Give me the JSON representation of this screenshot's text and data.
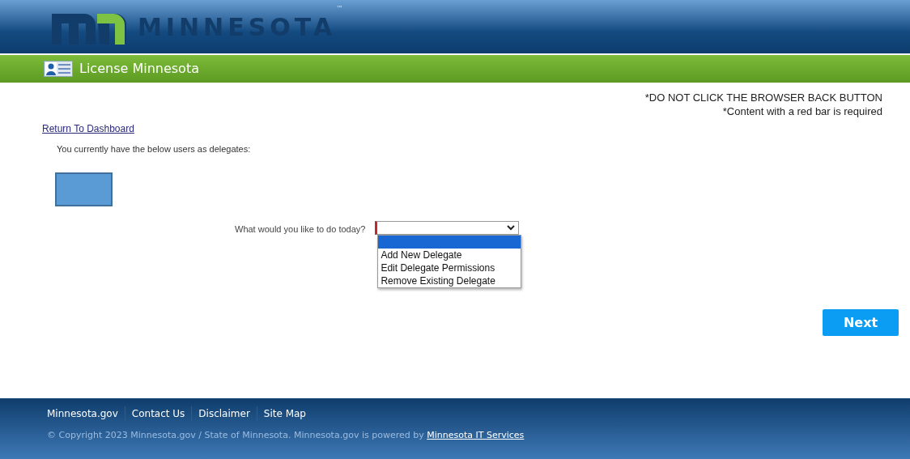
{
  "header": {
    "brand": "MINNESOTA",
    "trademark": "™"
  },
  "app_bar": {
    "title": "License Minnesota"
  },
  "notices": [
    "*DO NOT CLICK THE BROWSER BACK BUTTON",
    "*Content with a red bar is required"
  ],
  "back_link": "Return To Dashboard",
  "intro": "You currently have the below users as delegates:",
  "question": {
    "label": "What would you like to do today?",
    "required": true,
    "expanded": true,
    "blank_option_highlighted": true,
    "options": [
      {
        "label": "Add New Delegate",
        "selected": false
      },
      {
        "label": "Edit Delegate Permissions",
        "selected": false
      },
      {
        "label": "Remove Existing Delegate",
        "selected": false
      }
    ]
  },
  "next_button": "Next",
  "footer": {
    "links": [
      "Minnesota.gov",
      "Contact Us",
      "Disclaimer",
      "Site Map"
    ],
    "copyright": "© Copyright 2023 Minnesota.gov / State of Minnesota. Minnesota.gov is powered by ",
    "copyright_link": "Minnesota IT Services"
  }
}
